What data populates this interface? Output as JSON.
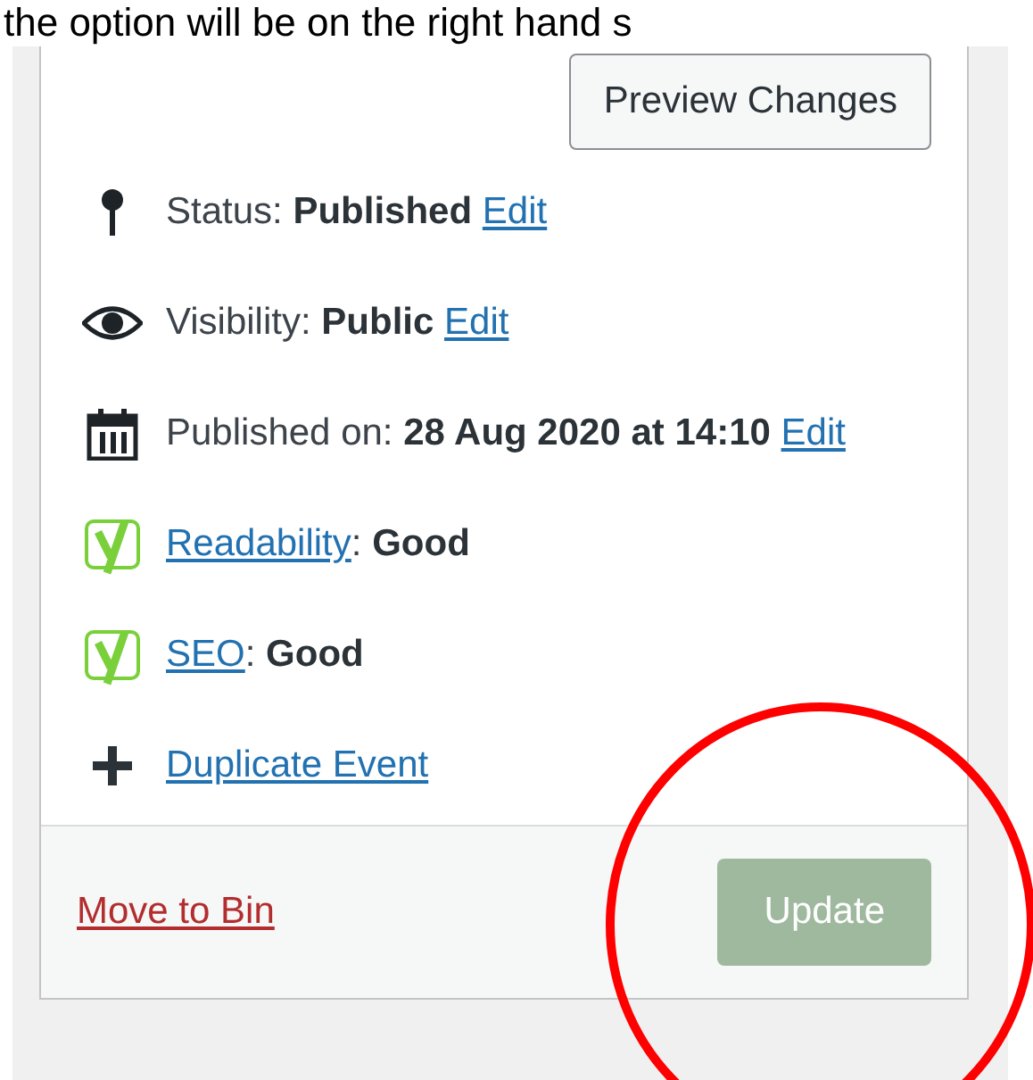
{
  "caption": "the option will be on the right hand s",
  "preview_button": "Preview Changes",
  "rows": [
    {
      "kind": "status",
      "label": "Status:",
      "value": "Published",
      "link": "Edit"
    },
    {
      "kind": "visibility",
      "label": "Visibility:",
      "value": "Public",
      "link": "Edit"
    },
    {
      "kind": "published",
      "label": "Published on:",
      "value": "28 Aug 2020 at 14:10",
      "link": "Edit"
    },
    {
      "kind": "readability",
      "link": "Readability",
      "separator": ":",
      "value": "Good"
    },
    {
      "kind": "seo",
      "link": "SEO",
      "separator": ":",
      "value": "Good"
    },
    {
      "kind": "duplicate",
      "link": "Duplicate Event"
    }
  ],
  "footer": {
    "delete_link": "Move to Bin",
    "update_button": {
      "label": "Update",
      "disabled": true
    }
  }
}
